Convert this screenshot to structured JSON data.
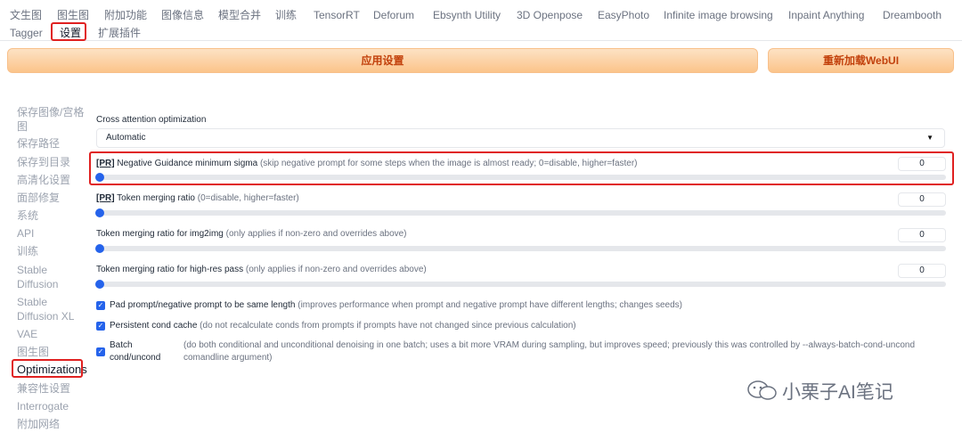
{
  "tabs": [
    "文生图",
    "图生图",
    "附加功能",
    "图像信息",
    "模型合并",
    "训练",
    "TensorRT",
    "Deforum",
    "Ebsynth Utility",
    "3D Openpose",
    "EasyPhoto",
    "Infinite image browsing",
    "Inpaint Anything",
    "Dreambooth",
    "Tagger",
    "设置",
    "扩展插件"
  ],
  "actions": {
    "apply": "应用设置",
    "reload": "重新加载WebUI"
  },
  "sidebar": [
    "保存图像/宫格",
    "图",
    "保存路径",
    "保存到目录",
    "高清化设置",
    "面部修复",
    "系统",
    "API",
    "训练",
    "Stable",
    "Diffusion",
    "Stable",
    "Diffusion XL",
    "VAE",
    "图生图",
    "Optimizations",
    "兼容性设置",
    "Interrogate",
    "附加网络"
  ],
  "settings": {
    "cross_attention": {
      "label": "Cross attention optimization",
      "value": "Automatic"
    },
    "neg_sigma": {
      "pr": "[PR]",
      "label": "Negative Guidance minimum sigma",
      "hint": "(skip negative prompt for some steps when the image is almost ready; 0=disable, higher=faster)",
      "value": "0"
    },
    "token_merge": {
      "pr": "[PR]",
      "label": "Token merging ratio",
      "hint": "(0=disable, higher=faster)",
      "value": "0"
    },
    "token_merge_img2img": {
      "label": "Token merging ratio for img2img",
      "hint": "(only applies if non-zero and overrides above)",
      "value": "0"
    },
    "token_merge_hr": {
      "label": "Token merging ratio for high-res pass",
      "hint": "(only applies if non-zero and overrides above)",
      "value": "0"
    },
    "pad_prompt": {
      "label": "Pad prompt/negative prompt to be same length",
      "hint": "(improves performance when prompt and negative prompt have different lengths; changes seeds)",
      "checked": true
    },
    "persistent_cond": {
      "label": "Persistent cond cache",
      "hint": "(do not recalculate conds from prompts if prompts have not changed since previous calculation)",
      "checked": true
    },
    "batch_cond": {
      "label_line1": "Batch",
      "label_line2": "cond/uncond",
      "hint_line1": "(do both conditional and unconditional denoising in one batch; uses a bit more VRAM during sampling, but improves speed; previously this was controlled by --always-batch-cond-uncond",
      "hint_line2": "comandline argument)",
      "checked": true
    }
  },
  "watermark": "小栗子AI笔记",
  "colors": {
    "accent": "#2563eb",
    "highlight": "#e02020",
    "button_text": "#c2410c"
  }
}
